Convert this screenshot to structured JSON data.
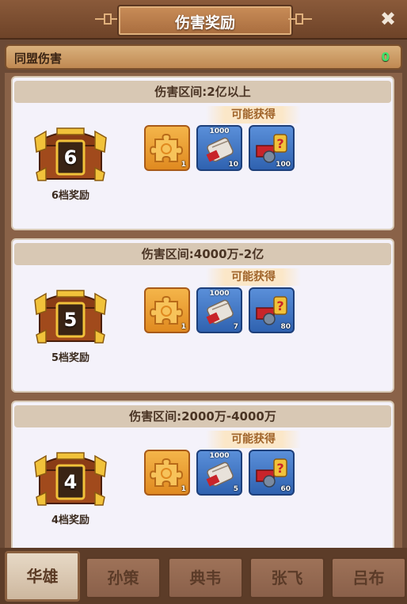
{
  "header": {
    "title": "伤害奖励",
    "close_glyph": "✖"
  },
  "alliance": {
    "label": "同盟伤害",
    "value": "0"
  },
  "possible_label": "可能获得",
  "cards": [
    {
      "range": "伤害区间:2亿以上",
      "tier": "6",
      "tier_label": "6档奖励",
      "items": [
        {
          "icon": "puzzle-icon",
          "color": "orange",
          "top": "",
          "count": "1"
        },
        {
          "icon": "scroll-icon",
          "color": "blue",
          "top": "1000",
          "count": "10"
        },
        {
          "icon": "mystery-gear-icon",
          "color": "blue",
          "top": "",
          "count": "100"
        }
      ]
    },
    {
      "range": "伤害区间:4000万-2亿",
      "tier": "5",
      "tier_label": "5档奖励",
      "items": [
        {
          "icon": "puzzle-icon",
          "color": "orange",
          "top": "",
          "count": "1"
        },
        {
          "icon": "scroll-icon",
          "color": "blue",
          "top": "1000",
          "count": "7"
        },
        {
          "icon": "mystery-gear-icon",
          "color": "blue",
          "top": "",
          "count": "80"
        }
      ]
    },
    {
      "range": "伤害区间:2000万-4000万",
      "tier": "4",
      "tier_label": "4档奖励",
      "items": [
        {
          "icon": "puzzle-icon",
          "color": "orange",
          "top": "",
          "count": "1"
        },
        {
          "icon": "scroll-icon",
          "color": "blue",
          "top": "1000",
          "count": "5"
        },
        {
          "icon": "mystery-gear-icon",
          "color": "blue",
          "top": "",
          "count": "60"
        }
      ]
    }
  ],
  "tabs": [
    {
      "label": "华雄",
      "active": true
    },
    {
      "label": "孙策",
      "active": false
    },
    {
      "label": "典韦",
      "active": false
    },
    {
      "label": "张飞",
      "active": false
    },
    {
      "label": "吕布",
      "active": false
    }
  ],
  "colors": {
    "accent_green": "#3fe36a",
    "panel_brown": "#6b4a36",
    "card_bg": "#f4f2fa"
  }
}
